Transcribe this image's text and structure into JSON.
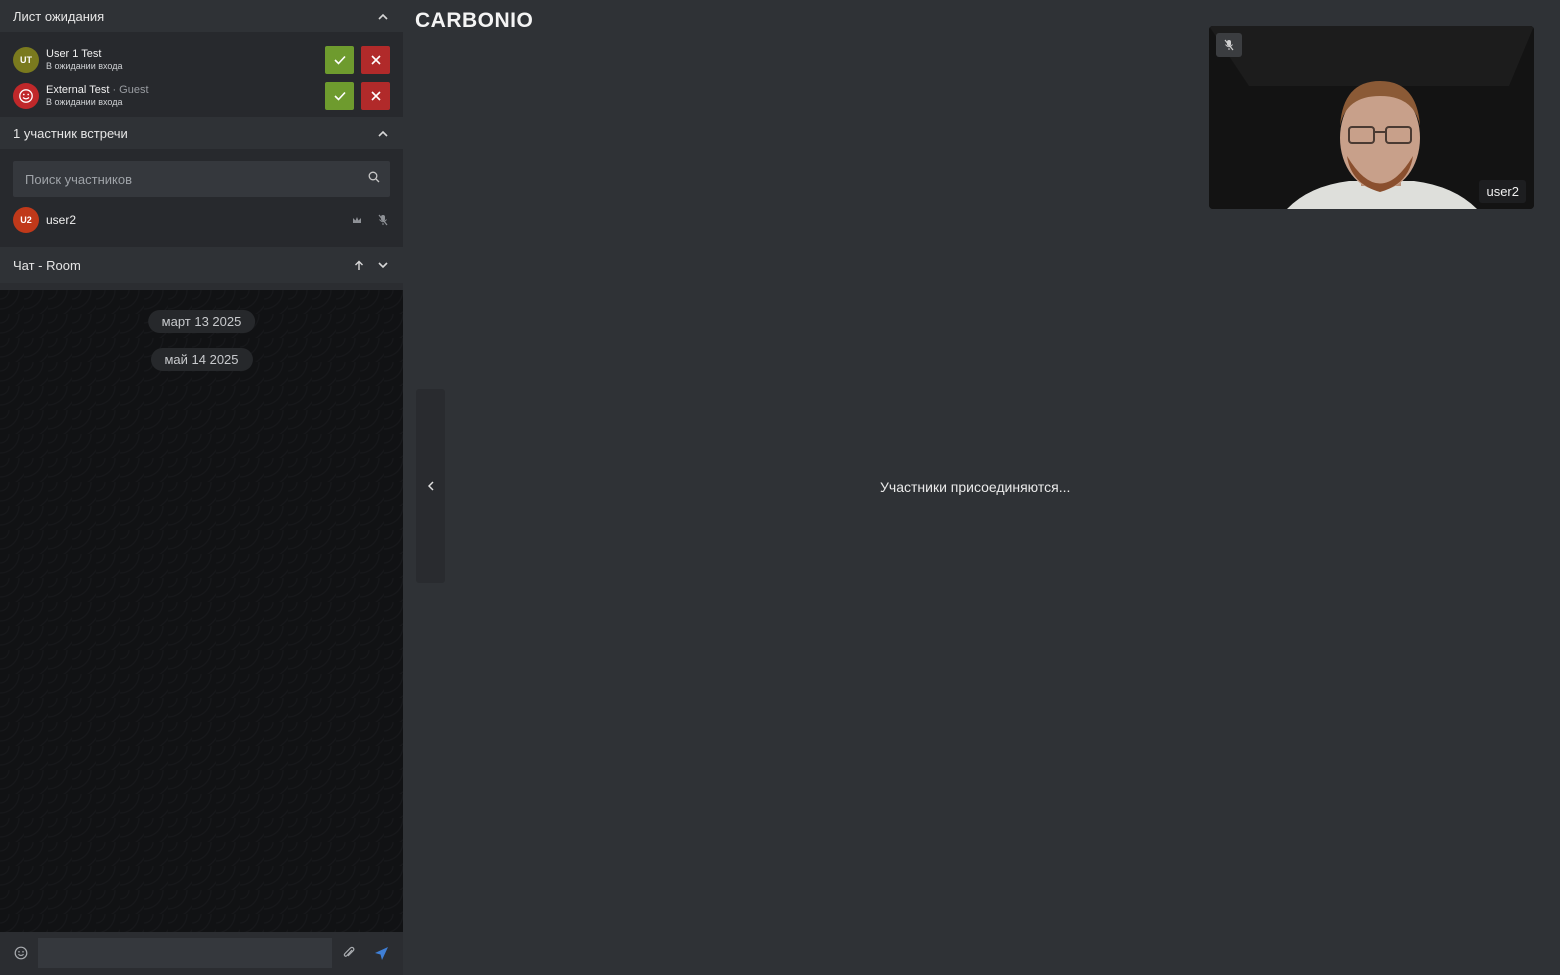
{
  "app": {
    "logo_text": "CARBONIO"
  },
  "waiting_list": {
    "title": "Лист ожидания",
    "items": [
      {
        "initials": "UT",
        "name": "User 1 Test",
        "role": "",
        "status": "В ожидании входа",
        "avatar_color": "#7a7a1e"
      },
      {
        "initials": "",
        "name": "External Test",
        "role": " · Guest",
        "status": "В ожидании входа",
        "avatar_color": "#c0282a"
      }
    ]
  },
  "participants": {
    "title": "1 участник встречи",
    "search_placeholder": "Поиск участников",
    "items": [
      {
        "initials": "U2",
        "name": "user2",
        "avatar_color": "#c0391a"
      }
    ]
  },
  "chat": {
    "title": "Чат - Room",
    "dates": [
      "март 13 2025",
      "май 14 2025"
    ],
    "input_value": ""
  },
  "main": {
    "joining_text": "Участники присоединяются...",
    "video_tile": {
      "name": "user2"
    }
  },
  "colors": {
    "accent_accept": "#6e9b2e",
    "accent_reject": "#b12a2a",
    "send_icon": "#3f7fd6"
  }
}
